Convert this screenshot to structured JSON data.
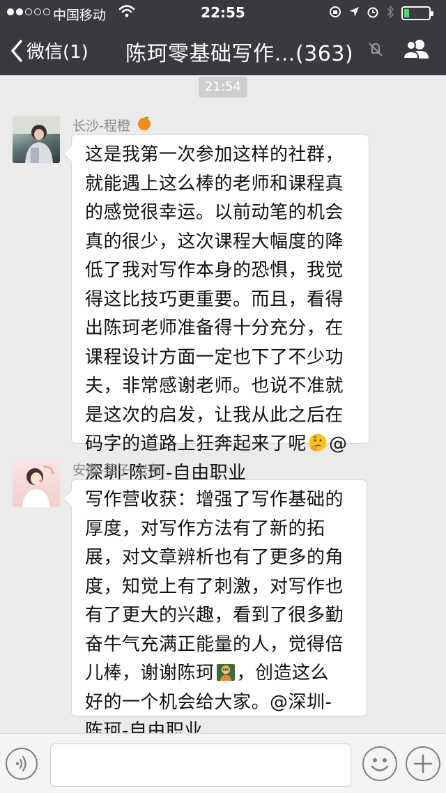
{
  "status_bar": {
    "carrier": "中国移动",
    "time": "22:55",
    "battery_level": 0.2
  },
  "nav": {
    "back_label": "微信(1)",
    "title": "陈珂零基础写作…(363)"
  },
  "chat": {
    "timestamp": "21:54",
    "messages": [
      {
        "sender": "长沙-程橙",
        "lines": [
          "这是我第一次参加这样的社群，",
          "就能遇上这么棒的老师和课程真",
          "的感觉很幸运。以前动笔的机会",
          "真的很少，这次课程大幅度的降",
          "低了我对写作本身的恐惧，我觉",
          "得这比技巧更重要。而且，看得",
          "出陈珂老师准备得十分充分，在",
          "课程设计方面一定也下了不少功",
          "夫，非常感谢老师。也说不准就",
          "是这次的启发，让我从此之后在",
          "码字的道路上狂奔起来了呢",
          "深圳-陈珂-自由职业"
        ],
        "line11_suffix": "@"
      },
      {
        "sender": "安徽-栗子-老师",
        "lines": [
          "写作营收获：增强了写作基础的",
          "厚度，对写作方法有了新的拓",
          "展，对文章辨析也有了更多的角",
          "度，知觉上有了刺激，对写作也",
          "有了更大的兴趣，看到了很多勤",
          "奋牛气充满正能量的人，觉得倍",
          "儿棒，谢谢陈珂",
          "好的一个机会给大家。@深圳-",
          "陈珂-自由职业"
        ],
        "line7_suffix": "，创造这么"
      }
    ]
  },
  "input_bar": {
    "message_value": ""
  },
  "colors": {
    "nav_bg": "#393a3f",
    "chat_bg": "#ebebeb",
    "bubble_bg": "#ffffff",
    "battery_green": "#4cd964"
  }
}
